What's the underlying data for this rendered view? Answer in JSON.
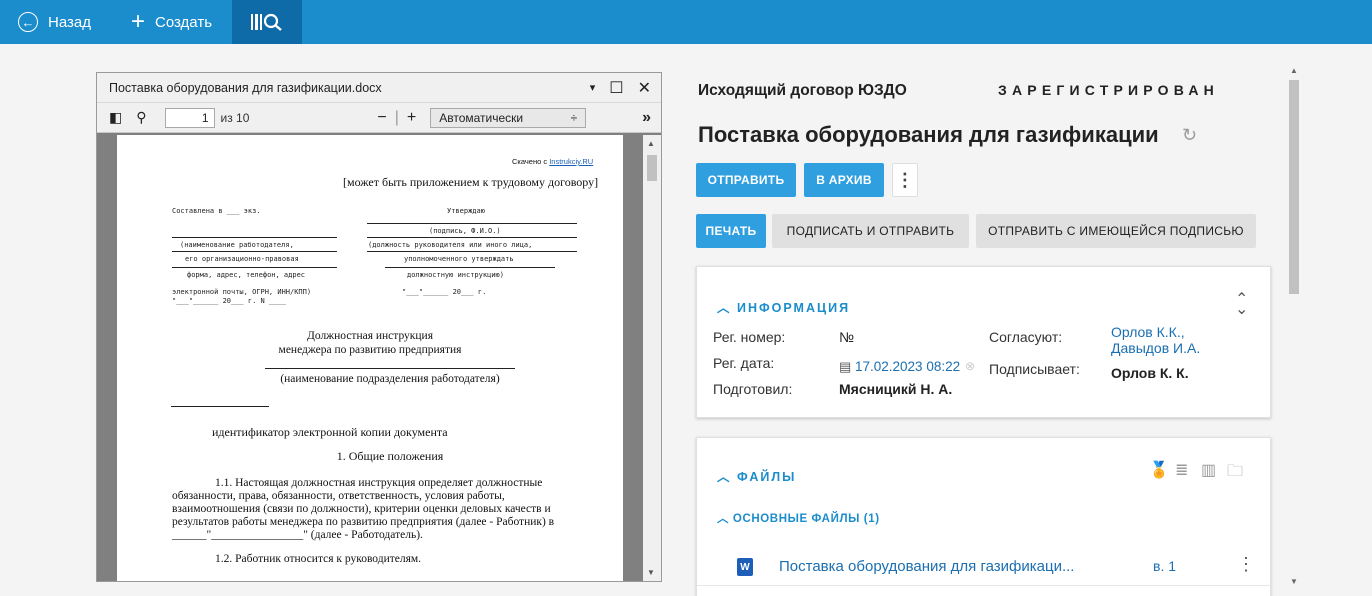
{
  "topbar": {
    "back_label": "Назад",
    "create_label": "Создать"
  },
  "viewer": {
    "filename": "Поставка оборудования для газификации.docx",
    "page_current": "1",
    "page_total": "из 10",
    "zoom_value": "Автоматически",
    "doc": {
      "source_prefix": "Скачено с ",
      "source_link": "Instrukciy.RU",
      "appendix_note": "[может быть приложением к трудовому договору]",
      "composed": "Составлена в ___ экз.",
      "approve": "Утверждаю",
      "sign_name": "(подпись, Ф.И.О.)",
      "employer_name": "(наименование работодателя,",
      "head_position": "(должность руководителя или иного лица,",
      "legal_form": "его организационно-правовая",
      "authorized": "уполномоченного утверждать",
      "address_form": "форма, адрес, телефон, адрес",
      "job_desc": "должностную инструкцию)",
      "email_ogrn": "электронной почты, ОГРН, ИНН/КПП)",
      "date_right": "\"___\"______ 20___ г.",
      "date_left": "\"___\"______ 20___ г. N ____",
      "title1": "Должностная инструкция",
      "title2": "менеджера по развитию предприятия",
      "dept_name": "(наименование подразделения работодателя)",
      "copy_id": "идентификатор электронной копии документа",
      "section1": "1. Общие положения",
      "p1_l1": "1.1. Настоящая должностная инструкция определяет должностные",
      "p1_l2": "обязанности, права, обязанности, ответственность, условия работы,",
      "p1_l3": "взаимоотношения (связи по должности), критерии оценки деловых качеств и",
      "p1_l4": "результатов работы менеджера по развитию предприятия (далее - Работник) в",
      "p1_l5": "______\"________________\" (далее - Работодатель).",
      "p2_l1": "1.2. Работник относится к руководителям."
    }
  },
  "panel": {
    "doc_type": "Исходящий договор ЮЗДО",
    "status": "ЗАРЕГИСТРИРОВАН",
    "title": "Поставка оборудования для газификации",
    "buttons": {
      "send": "ОТПРАВИТЬ",
      "archive": "В АРХИВ",
      "print": "ПЕЧАТЬ",
      "sign_send": "ПОДПИСАТЬ И ОТПРАВИТЬ",
      "send_existing": "ОТПРАВИТЬ С ИМЕЮЩЕЙСЯ ПОДПИСЬЮ"
    },
    "info": {
      "header": "ИНФОРМАЦИЯ",
      "reg_num_label": "Рег. номер:",
      "reg_num_value": "№",
      "reg_date_label": "Рег. дата:",
      "reg_date_value": "17.02.2023 08:22",
      "prepared_label": "Подготовил:",
      "prepared_value": "Мясницикй Н. А.",
      "approvers_label": "Согласуют:",
      "approver1": "Орлов К.К.,",
      "approver2": "Давыдов И.А.",
      "signer_label": "Подписывает:",
      "signer_value": "Орлов К. К."
    },
    "files": {
      "header": "ФАЙЛЫ",
      "main_header": "ОСНОВНЫЕ ФАЙЛЫ (1)",
      "file_name": "Поставка оборудования для газификаци...",
      "file_version": "в. 1",
      "file_badge": "W"
    }
  }
}
